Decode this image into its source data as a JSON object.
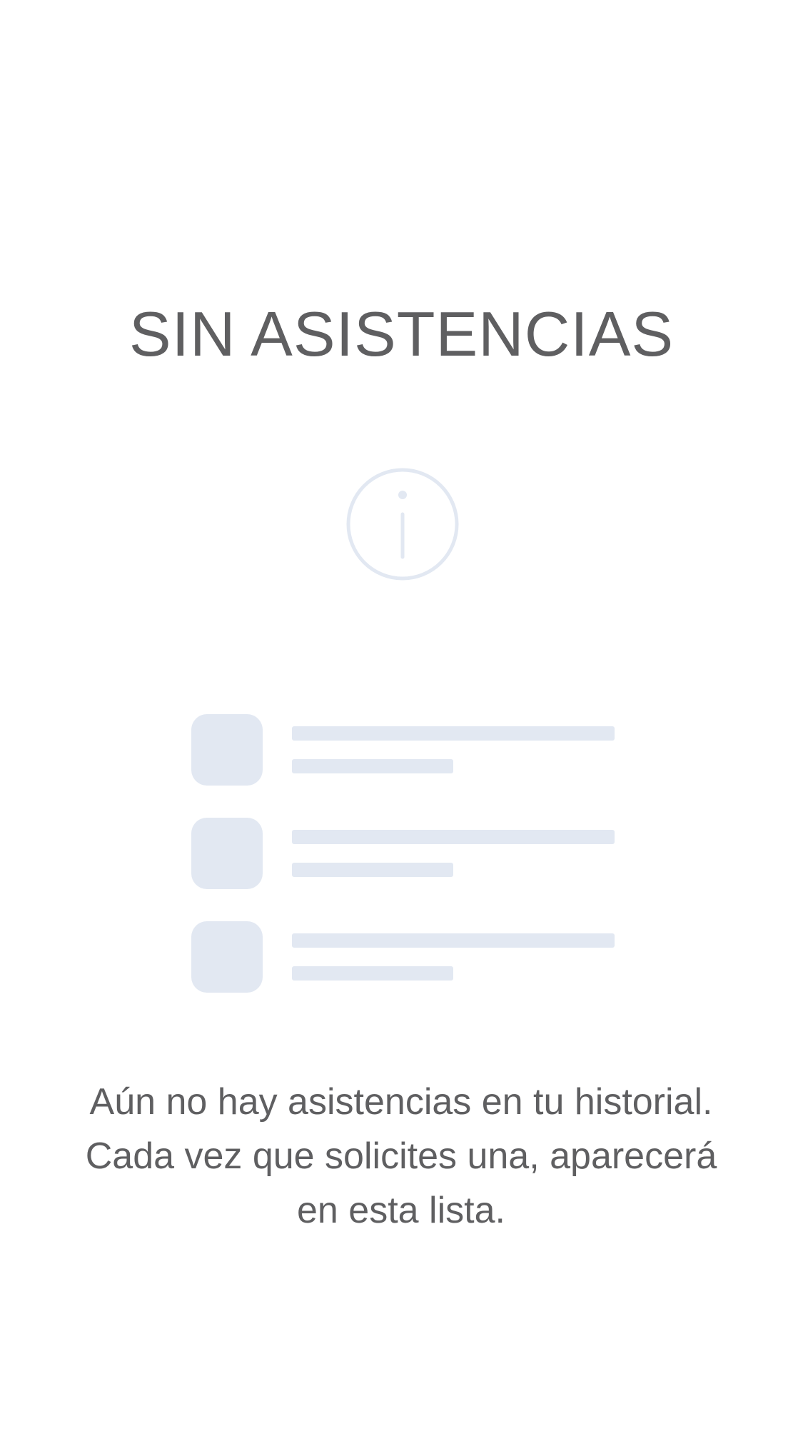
{
  "empty_state": {
    "title": "SIN ASISTENCIAS",
    "icon": "info-icon",
    "icon_color": "#e2e8f2",
    "placeholder_rows": 3,
    "message": "Aún no hay asistencias en tu historial. Cada vez que solicites una, aparecerá en esta lista.",
    "text_color": "#5f5f61",
    "placeholder_color": "#e2e8f2"
  }
}
